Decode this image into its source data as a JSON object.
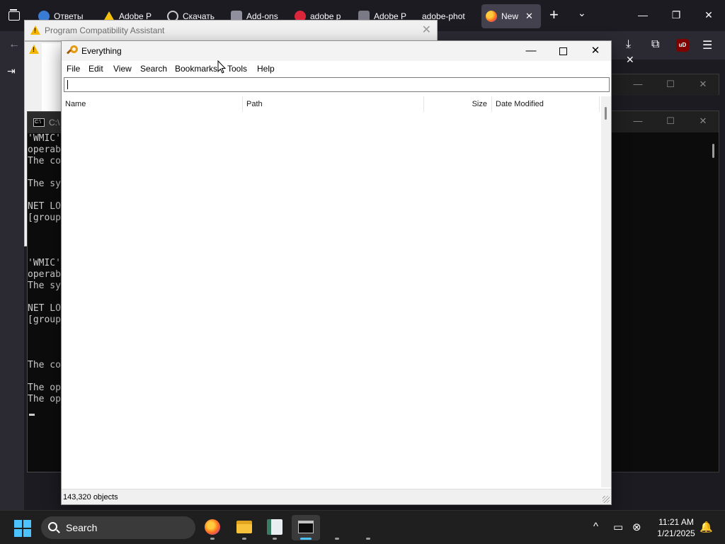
{
  "browser": {
    "tabs": [
      {
        "label": "Ответы",
        "icon": "question-favicon-icon"
      },
      {
        "label": "Adobe P",
        "icon": "drive-favicon-icon"
      },
      {
        "label": "Скачать",
        "icon": "circle-favicon-icon"
      },
      {
        "label": "Add-ons",
        "icon": "puzzle-favicon-icon"
      },
      {
        "label": "adobe p",
        "icon": "yandex-favicon-icon"
      },
      {
        "label": "Adobe P",
        "icon": "generic-favicon-icon"
      },
      {
        "label": "adobe-phot",
        "icon": "none"
      },
      {
        "label": "New",
        "icon": "firefox-favicon-icon",
        "active": true,
        "close": "✕"
      }
    ],
    "new_tab": "+",
    "tab_list": "⌄",
    "window_controls": {
      "minimize": "—",
      "restore": "❐",
      "close": "✕"
    },
    "ublock_label": "uD"
  },
  "pca": {
    "title": "Program Compatibility Assistant",
    "close": "✕"
  },
  "cmd": {
    "title": "C:\\",
    "lines": "'WMIC'\noperab\nThe co\n\nThe sy\n\nNET LO\n[group\n\n\n\n'WMIC'\noperab\nThe sy\n\nNET LO\n[group\n\n\n\nThe co\n\nThe op\nThe op"
  },
  "everything": {
    "title": "Everything",
    "controls": {
      "minimize": "—",
      "maximize": "",
      "close": "✕"
    },
    "menu": [
      "File",
      "Edit",
      "View",
      "Search",
      "Bookmarks",
      "Tools",
      "Help"
    ],
    "search_value": "",
    "columns": [
      "Name",
      "Path",
      "Size",
      "Date Modified"
    ],
    "status": "143,320 objects"
  },
  "taskbar": {
    "search_label": "Search",
    "apps": [
      "firefox-icon",
      "file-explorer-icon",
      "notepad-icon",
      "terminal-icon",
      "app-5",
      "app-6"
    ],
    "tray": {
      "chevron": "^"
    },
    "time": "11:21 AM",
    "date": "1/21/2025"
  },
  "colors": {
    "accent": "#4cc2ff",
    "firefox_dark": "#1c1b22",
    "toolbar": "#2b2a33",
    "warning": "#f2b500"
  }
}
